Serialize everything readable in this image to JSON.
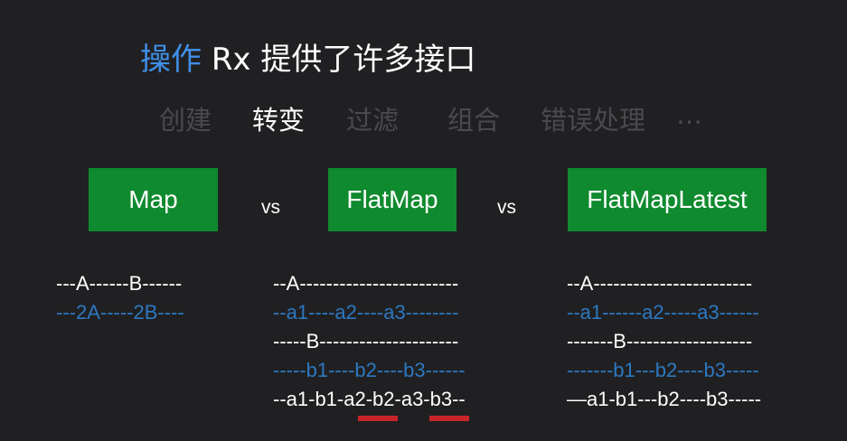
{
  "title": {
    "accent": "操作",
    "rest": "Rx 提供了许多接口"
  },
  "tabs": [
    {
      "label": "创建",
      "active": false
    },
    {
      "label": "转变",
      "active": true
    },
    {
      "label": "过滤",
      "active": false
    },
    {
      "label": "组合",
      "active": false
    },
    {
      "label": "错误处理",
      "active": false
    },
    {
      "label": "…",
      "active": false
    }
  ],
  "operators": [
    "Map",
    "FlatMap",
    "FlatMapLatest"
  ],
  "vs_label": "vs",
  "diagrams": {
    "map": [
      "---A------B------",
      "---2A-----2B----"
    ],
    "flatmap": [
      "--A------------------------",
      "--a1----a2----a3--------",
      "-----B---------------------",
      "-----b1----b2----b3------",
      "--a1-b1-a2-b2-a3-b3--"
    ],
    "flatmaplatest": [
      "--A------------------------",
      "--a1------a2-----a3------",
      "-------B-------------------",
      "-------b1---b2----b3-----",
      "—a1-b1---b2----b3-----"
    ]
  },
  "colors": {
    "accent": "#3f8fe8",
    "box": "#0f8a2e",
    "stream_blue": "#2d78c0",
    "underline": "#c8242a",
    "dim": "#4a4a4c"
  }
}
